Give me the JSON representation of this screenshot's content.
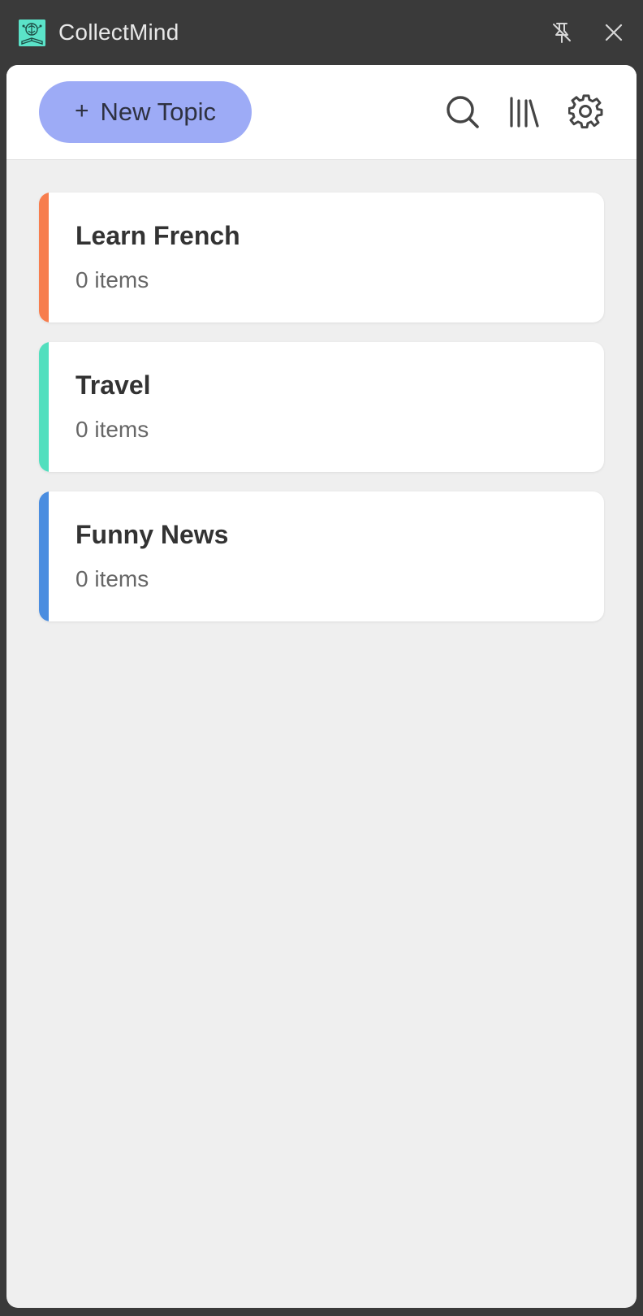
{
  "window": {
    "title": "CollectMind",
    "logo_icon": "brain-book-icon",
    "logo_color": "#5be3c9"
  },
  "toolbar": {
    "new_topic_label": "New Topic",
    "new_topic_icon": "plus-icon",
    "new_topic_color": "#9dabf6",
    "icons": [
      "search-icon",
      "library-icon",
      "gear-icon"
    ]
  },
  "topics": [
    {
      "name": "Learn French",
      "count": "0 items",
      "color": "#f77d4d"
    },
    {
      "name": "Travel",
      "count": "0 items",
      "color": "#52dfbe"
    },
    {
      "name": "Funny News",
      "count": "0 items",
      "color": "#4a8de0"
    }
  ]
}
